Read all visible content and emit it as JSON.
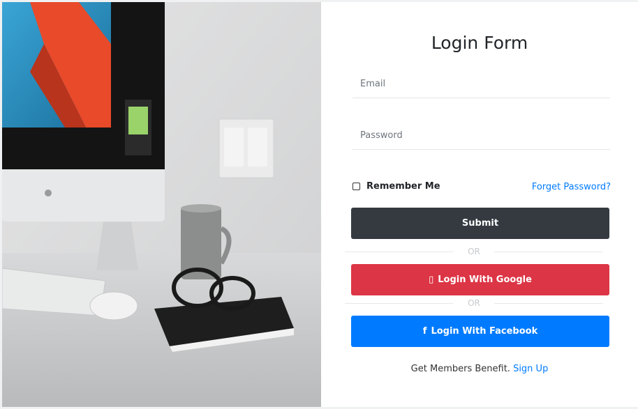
{
  "form": {
    "title": "Login Form",
    "email_placeholder": "Email",
    "password_placeholder": "Password",
    "remember_label": "Remember Me",
    "forget_label": "Forget Password?",
    "submit_label": "Submit",
    "or_label_1": "OR",
    "or_label_2": "OR",
    "google_label": "Login With Google",
    "facebook_label": "Login With Facebook",
    "footer_text": "Get Members Benefit.",
    "footer_link": "Sign Up",
    "facebook_glyph": "f",
    "google_icon_glyph": "▯"
  },
  "colors": {
    "dark": "#343a40",
    "google": "#dc3545",
    "facebook": "#007bff",
    "link": "#007bff"
  },
  "icons": {
    "google": "google-icon",
    "facebook": "facebook-icon"
  }
}
